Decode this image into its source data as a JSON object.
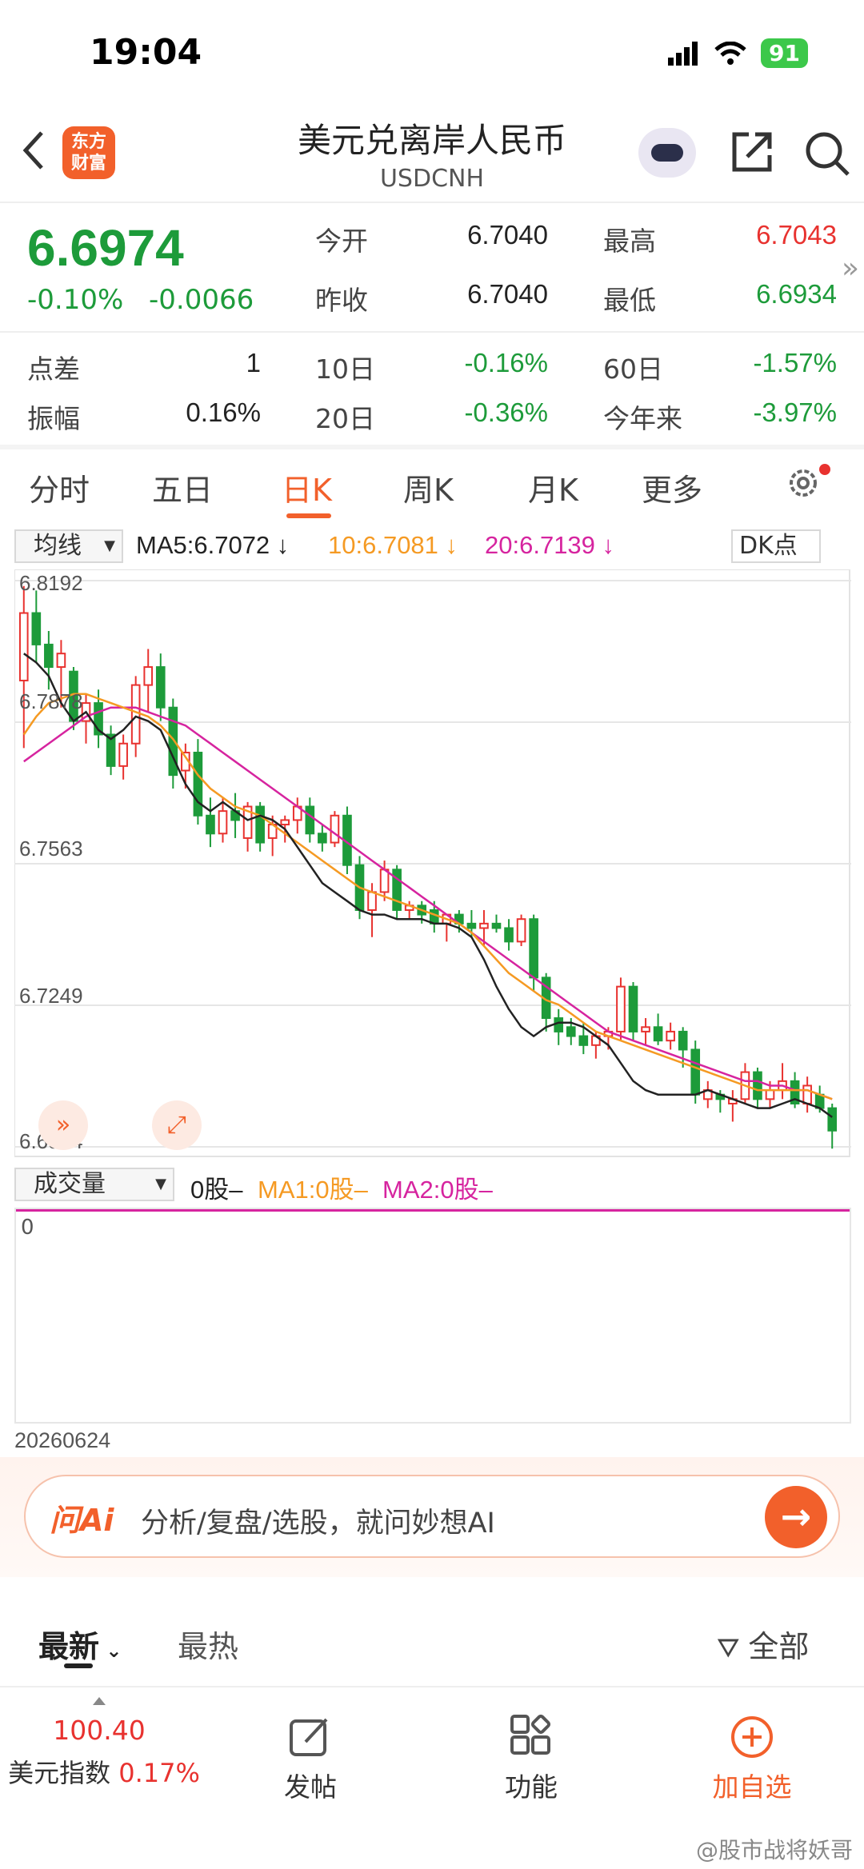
{
  "status": {
    "time": "19:04",
    "battery": "91"
  },
  "nav": {
    "logo_line1": "东方",
    "logo_line2": "财富",
    "title": "美元兑离岸人民币",
    "subtitle": "USDCNH"
  },
  "quote": {
    "price": "6.6974",
    "pct": "-0.10%",
    "change": "-0.0066",
    "open_label": "今开",
    "open": "6.7040",
    "high_label": "最高",
    "high": "6.7043",
    "prev_label": "昨收",
    "prev": "6.7040",
    "low_label": "最低",
    "low": "6.6934",
    "spread_label": "点差",
    "spread": "1",
    "d10_label": "10日",
    "d10": "-0.16%",
    "d60_label": "60日",
    "d60": "-1.57%",
    "amp_label": "振幅",
    "amp": "0.16%",
    "d20_label": "20日",
    "d20": "-0.36%",
    "ytd_label": "今年来",
    "ytd": "-3.97%"
  },
  "tabs": [
    "分时",
    "五日",
    "日K",
    "周K",
    "月K",
    "更多"
  ],
  "ma": {
    "selector": "均线",
    "ma5": "MA5:6.7072 ↓",
    "ma10": "10:6.7081 ↓",
    "ma20": "20:6.7139 ↓",
    "dk": "DK点",
    "colors": {
      "ma5": "#222222",
      "ma10": "#f59a23",
      "ma20": "#d6249f",
      "up": "#e8322f",
      "down": "#1d9b3a"
    }
  },
  "chart_data": {
    "type": "candlestick",
    "y_ticks": [
      "6.8192",
      "6.7878",
      "6.7563",
      "6.7249",
      "6.6934"
    ],
    "ylim": [
      6.6934,
      6.8192
    ],
    "candles": [
      [
        6.797,
        6.818,
        6.782,
        6.812
      ],
      [
        6.812,
        6.817,
        6.801,
        6.805
      ],
      [
        6.805,
        6.808,
        6.795,
        6.8
      ],
      [
        6.8,
        6.806,
        6.791,
        6.803
      ],
      [
        6.799,
        6.8,
        6.786,
        6.788
      ],
      [
        6.788,
        6.794,
        6.783,
        6.792
      ],
      [
        6.792,
        6.795,
        6.782,
        6.785
      ],
      [
        6.785,
        6.787,
        6.776,
        6.778
      ],
      [
        6.778,
        6.785,
        6.775,
        6.783
      ],
      [
        6.783,
        6.798,
        6.78,
        6.796
      ],
      [
        6.796,
        6.804,
        6.79,
        6.8
      ],
      [
        6.8,
        6.803,
        6.788,
        6.791
      ],
      [
        6.791,
        6.793,
        6.773,
        6.776
      ],
      [
        6.777,
        6.783,
        6.773,
        6.781
      ],
      [
        6.781,
        6.784,
        6.765,
        6.767
      ],
      [
        6.767,
        6.771,
        6.76,
        6.763
      ],
      [
        6.763,
        6.771,
        6.761,
        6.768
      ],
      [
        6.768,
        6.772,
        6.762,
        6.766
      ],
      [
        6.762,
        6.77,
        6.759,
        6.769
      ],
      [
        6.769,
        6.77,
        6.759,
        6.761
      ],
      [
        6.762,
        6.767,
        6.758,
        6.765
      ],
      [
        6.765,
        6.767,
        6.761,
        6.766
      ],
      [
        6.766,
        6.771,
        6.763,
        6.769
      ],
      [
        6.769,
        6.771,
        6.761,
        6.763
      ],
      [
        6.763,
        6.765,
        6.759,
        6.761
      ],
      [
        6.761,
        6.768,
        6.76,
        6.767
      ],
      [
        6.767,
        6.769,
        6.754,
        6.756
      ],
      [
        6.756,
        6.758,
        6.744,
        6.746
      ],
      [
        6.746,
        6.752,
        6.74,
        6.75
      ],
      [
        6.75,
        6.757,
        6.748,
        6.755
      ],
      [
        6.755,
        6.756,
        6.744,
        6.746
      ],
      [
        6.746,
        6.748,
        6.744,
        6.747
      ],
      [
        6.747,
        6.748,
        6.743,
        6.745
      ],
      [
        6.746,
        6.748,
        6.741,
        6.743
      ],
      [
        6.743,
        6.745,
        6.739,
        6.745
      ],
      [
        6.745,
        6.746,
        6.741,
        6.743
      ],
      [
        6.743,
        6.746,
        6.74,
        6.742
      ],
      [
        6.742,
        6.746,
        6.738,
        6.743
      ],
      [
        6.743,
        6.745,
        6.741,
        6.742
      ],
      [
        6.742,
        6.744,
        6.737,
        6.739
      ],
      [
        6.739,
        6.745,
        6.738,
        6.744
      ],
      [
        6.744,
        6.745,
        6.728,
        6.731
      ],
      [
        6.731,
        6.732,
        6.719,
        6.722
      ],
      [
        6.722,
        6.724,
        6.716,
        6.719
      ],
      [
        6.72,
        6.722,
        6.716,
        6.718
      ],
      [
        6.718,
        6.721,
        6.714,
        6.716
      ],
      [
        6.716,
        6.719,
        6.713,
        6.718
      ],
      [
        6.718,
        6.72,
        6.715,
        6.719
      ],
      [
        6.719,
        6.731,
        6.717,
        6.729
      ],
      [
        6.729,
        6.73,
        6.717,
        6.719
      ],
      [
        6.719,
        6.722,
        6.716,
        6.72
      ],
      [
        6.72,
        6.723,
        6.716,
        6.717
      ],
      [
        6.717,
        6.721,
        6.715,
        6.719
      ],
      [
        6.719,
        6.72,
        6.711,
        6.715
      ],
      [
        6.715,
        6.717,
        6.703,
        6.705
      ],
      [
        6.704,
        6.708,
        6.702,
        6.706
      ],
      [
        6.705,
        6.706,
        6.701,
        6.704
      ],
      [
        6.703,
        6.706,
        6.699,
        6.704
      ],
      [
        6.704,
        6.712,
        6.703,
        6.71
      ],
      [
        6.71,
        6.711,
        6.702,
        6.704
      ],
      [
        6.704,
        6.708,
        6.702,
        6.706
      ],
      [
        6.706,
        6.712,
        6.704,
        6.708
      ],
      [
        6.708,
        6.71,
        6.702,
        6.703
      ],
      [
        6.703,
        6.709,
        6.701,
        6.707
      ],
      [
        6.705,
        6.707,
        6.701,
        6.702
      ],
      [
        6.702,
        6.703,
        6.693,
        6.697
      ]
    ],
    "ma5": [
      6.803,
      6.801,
      6.798,
      6.792,
      6.788,
      6.79,
      6.786,
      6.784,
      6.786,
      6.789,
      6.788,
      6.786,
      6.78,
      6.774,
      6.77,
      6.768,
      6.77,
      6.768,
      6.766,
      6.767,
      6.766,
      6.764,
      6.76,
      6.756,
      6.752,
      6.75,
      6.748,
      6.746,
      6.745,
      6.745,
      6.744,
      6.744,
      6.744,
      6.743,
      6.743,
      6.742,
      6.74,
      6.735,
      6.729,
      6.724,
      6.72,
      6.718,
      6.72,
      6.721,
      6.721,
      6.72,
      6.718,
      6.716,
      6.712,
      6.708,
      6.706,
      6.705,
      6.705,
      6.705,
      6.705,
      6.706,
      6.705,
      6.704,
      6.703,
      6.702,
      6.702,
      6.703,
      6.704,
      6.703,
      6.702,
      6.7
    ],
    "ma10": [
      6.785,
      6.789,
      6.792,
      6.793,
      6.794,
      6.794,
      6.793,
      6.792,
      6.791,
      6.79,
      6.789,
      6.787,
      6.784,
      6.78,
      6.776,
      6.773,
      6.771,
      6.769,
      6.768,
      6.767,
      6.765,
      6.763,
      6.761,
      6.759,
      6.757,
      6.755,
      6.753,
      6.751,
      6.75,
      6.749,
      6.748,
      6.747,
      6.746,
      6.745,
      6.744,
      6.743,
      6.741,
      6.738,
      6.735,
      6.732,
      6.73,
      6.728,
      6.726,
      6.725,
      6.723,
      6.721,
      6.719,
      6.718,
      6.717,
      6.716,
      6.715,
      6.714,
      6.713,
      6.712,
      6.711,
      6.71,
      6.709,
      6.708,
      6.707,
      6.706,
      6.706,
      6.706,
      6.706,
      6.706,
      6.705,
      6.704
    ],
    "ma20": [
      6.779,
      6.781,
      6.783,
      6.785,
      6.787,
      6.789,
      6.79,
      6.791,
      6.791,
      6.791,
      6.79,
      6.789,
      6.788,
      6.787,
      6.785,
      6.783,
      6.781,
      6.779,
      6.777,
      6.775,
      6.773,
      6.771,
      6.769,
      6.767,
      6.765,
      6.763,
      6.761,
      6.759,
      6.757,
      6.755,
      6.753,
      6.751,
      6.749,
      6.747,
      6.745,
      6.743,
      6.741,
      6.739,
      6.737,
      6.735,
      6.733,
      6.731,
      6.729,
      6.727,
      6.725,
      6.723,
      6.721,
      6.719,
      6.718,
      6.717,
      6.716,
      6.715,
      6.714,
      6.713,
      6.712,
      6.711,
      6.71,
      6.709,
      6.708,
      6.708,
      6.707,
      6.707,
      6.706,
      6.706,
      6.705,
      6.704
    ]
  },
  "volume": {
    "selector": "成交量",
    "vol": "0股–",
    "ma1": "MA1:0股–",
    "ma2": "MA2:0股–",
    "axis_zero": "0",
    "date": "20260624"
  },
  "ai": {
    "logo": "问Ai",
    "placeholder": "分析/复盘/选股，就问妙想AI",
    "go": "→"
  },
  "feed": {
    "latest": "最新",
    "hot": "最热",
    "all": "全部"
  },
  "bottom": {
    "index_value": "100.40",
    "index_name": "美元指数",
    "index_pct": "0.17%",
    "post": "发帖",
    "func": "功能",
    "add": "加自选"
  },
  "watermark": "@股市战将妖哥"
}
